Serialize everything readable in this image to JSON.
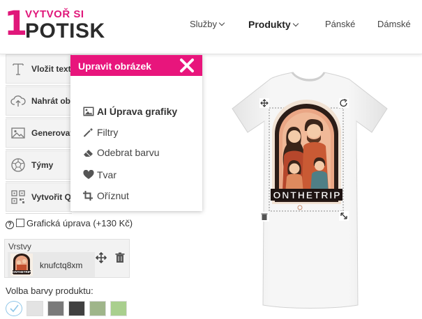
{
  "header": {
    "logo": {
      "digit": "1",
      "top": "VYTVOŘ SI",
      "bottom": "POTISK"
    },
    "nav": [
      {
        "label": "Služby",
        "dropdown": true
      },
      {
        "label": "Produkty",
        "dropdown": true
      },
      {
        "label": "Pánské",
        "dropdown": false
      },
      {
        "label": "Dámské",
        "dropdown": false
      }
    ]
  },
  "sidebar": {
    "tools": [
      {
        "label": "Vložit text",
        "icon": "text-icon"
      },
      {
        "label": "Nahrát obr",
        "icon": "upload-cloud-icon"
      },
      {
        "label": "Generovat",
        "icon": "image-icon"
      },
      {
        "label": "Týmy",
        "icon": "football-icon"
      },
      {
        "label": "Vytvořit QR",
        "icon": "qr-code-icon"
      }
    ],
    "graphic_edit_label": "Grafická úprava (+130 Kč)",
    "layers_label": "Vrstvy",
    "layer": {
      "name": "knufctq8xm"
    },
    "color_label": "Volba barvy produktu:",
    "swatches": [
      "#ffffff",
      "#e3e3e3",
      "#7a7a7a",
      "#404040",
      "#9fb58a",
      "#a9cf8e"
    ]
  },
  "popup": {
    "title": "Upravit obrázek",
    "items": [
      {
        "label": "AI Úprava grafiky",
        "icon": "image-icon",
        "bold": true
      },
      {
        "label": "Filtry",
        "icon": "magic-wand-icon",
        "bold": false
      },
      {
        "label": "Odebrat barvu",
        "icon": "eraser-icon",
        "bold": false
      },
      {
        "label": "Tvar",
        "icon": "heart-icon",
        "bold": false
      },
      {
        "label": "Oříznut",
        "icon": "crop-icon",
        "bold": false
      }
    ]
  },
  "design": {
    "print_text": "ONTHETRIP"
  },
  "colors": {
    "brand": "#e8157c",
    "tshirt": "#f2f2f2"
  }
}
